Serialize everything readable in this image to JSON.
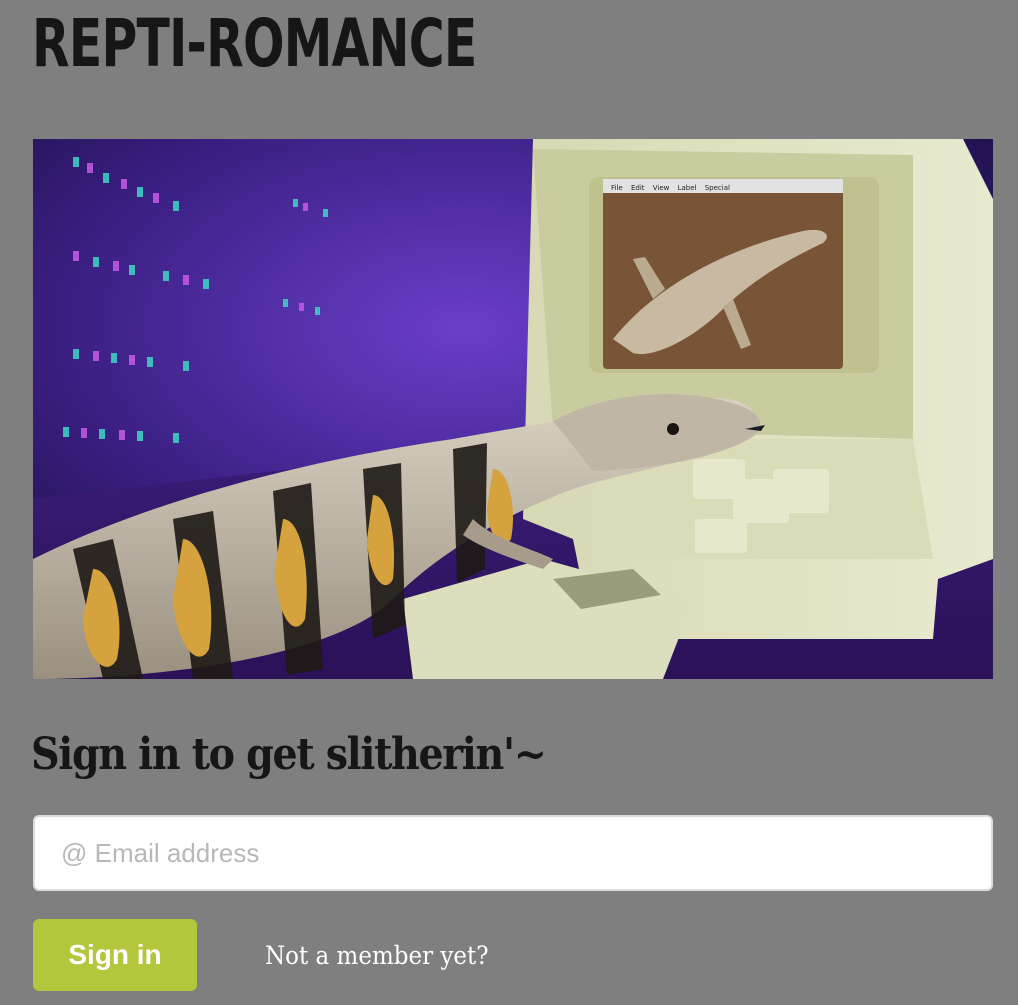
{
  "header": {
    "brand": "REPTI-ROMANCE"
  },
  "hero": {
    "screen_menu": [
      "File",
      "Edit",
      "View",
      "Label",
      "Special"
    ]
  },
  "signin": {
    "heading": "Sign in to get slitherin'~",
    "email_placeholder": "@ Email address",
    "button_label": "Sign in",
    "member_link": "Not a member yet?"
  },
  "colors": {
    "background": "#7f7f7f",
    "button": "#b4c63b",
    "heading": "#161616"
  }
}
